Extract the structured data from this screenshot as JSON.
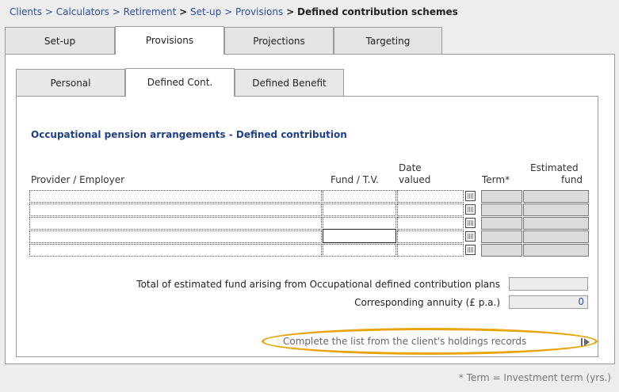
{
  "breadcrumb": {
    "items": [
      "Clients",
      "Calculators",
      "Retirement",
      "Set-up",
      "Provisions"
    ],
    "separator": ">",
    "current": "Defined contribution schemes"
  },
  "tabs": [
    {
      "label": "Set-up",
      "active": false
    },
    {
      "label": "Provisions",
      "active": true
    },
    {
      "label": "Projections",
      "active": false
    },
    {
      "label": "Targeting",
      "active": false
    }
  ],
  "subtabs": [
    {
      "label": "Personal",
      "active": false
    },
    {
      "label": "Defined Cont.",
      "active": true
    },
    {
      "label": "Defined Benefit",
      "active": false
    }
  ],
  "section_title": "Occupational pension arrangements - Defined contribution",
  "table": {
    "headers": {
      "provider": "Provider / Employer",
      "fund": "Fund / T.V.",
      "date_top": "Date",
      "date_bottom": "valued",
      "term": "Term*",
      "est_top": "Estimated",
      "est_bottom": "fund"
    },
    "rows": [
      {
        "provider": "",
        "fund": "",
        "date": "",
        "term": "",
        "est": ""
      },
      {
        "provider": "",
        "fund": "",
        "date": "",
        "term": "",
        "est": ""
      },
      {
        "provider": "",
        "fund": "",
        "date": "",
        "term": "",
        "est": ""
      },
      {
        "provider": "",
        "fund": "",
        "date": "",
        "term": "",
        "est": ""
      },
      {
        "provider": "",
        "fund": "",
        "date": "",
        "term": "",
        "est": ""
      }
    ]
  },
  "totals": {
    "total_label": "Total of estimated fund arising from Occupational defined contribution plans",
    "total_value": "",
    "annuity_label": "Corresponding annuity (£ p.a.)",
    "annuity_value": "0"
  },
  "complete_link": "Complete the list from the client's holdings records",
  "footnote": "* Term = Investment term (yrs.)",
  "colors": {
    "link": "#2b4fa1",
    "highlight_ring": "#e8a40a",
    "title": "#1f3f8a"
  }
}
